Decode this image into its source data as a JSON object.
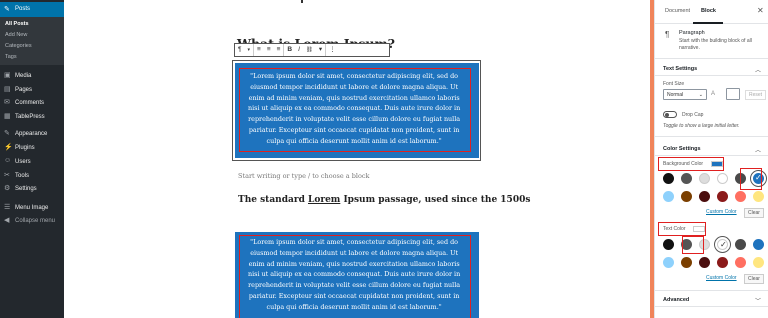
{
  "admin_menu": {
    "posts_label": "Posts",
    "sub_items": [
      "All Posts",
      "Add New",
      "Categories",
      "Tags"
    ],
    "items": [
      {
        "label": "Media",
        "icon": "media-icon",
        "glyph": "▣"
      },
      {
        "label": "Pages",
        "icon": "pages-icon",
        "glyph": "▤"
      },
      {
        "label": "Comments",
        "icon": "comments-icon",
        "glyph": "✉"
      },
      {
        "label": "TablePress",
        "icon": "tablepress-icon",
        "glyph": "▦"
      },
      {
        "label": "Appearance",
        "icon": "appearance-icon",
        "glyph": "✎"
      },
      {
        "label": "Plugins",
        "icon": "plugins-icon",
        "glyph": "⚡"
      },
      {
        "label": "Users",
        "icon": "users-icon",
        "glyph": "☺"
      },
      {
        "label": "Tools",
        "icon": "tools-icon",
        "glyph": "✂"
      },
      {
        "label": "Settings",
        "icon": "settings-icon",
        "glyph": "⚙"
      },
      {
        "label": "Menu Image",
        "icon": "menu-image-icon",
        "glyph": "☰"
      },
      {
        "label": "Collapse menu",
        "icon": "collapse-icon",
        "glyph": "◀"
      }
    ]
  },
  "editor": {
    "heading1": "What is Lorem Ipsum?",
    "toolbar": {
      "paragraph": "¶",
      "align_left": "≡",
      "align_center": "≡",
      "align_right": "≡",
      "bold": "B",
      "italic": "I",
      "link": "🔗",
      "more": "▾",
      "options": "⋮"
    },
    "paragraph_lines": [
      "\"Lorem  ipsum dolor sit amet, consectetur adipiscing elit, sed do",
      "eiusmod  tempor incididunt ut labore et dolore magna aliqua. Ut",
      "enim ad minim  veniam, quis nostrud exercitation ullamco laboris",
      "nisi ut aliquip ex ea  commodo consequat. Duis aute irure dolor in",
      "reprehenderit in voluptate  velit esse cillum dolore eu fugiat nulla",
      "pariatur. Excepteur sint  occaecat cupidatat non proident, sunt in",
      "culpa qui officia deserunt  mollit anim id est laborum.\""
    ],
    "placeholder": "Start writing or type / to choose a block",
    "heading2_prefix": "The standard ",
    "heading2_underlined": "Lorem",
    "heading2_suffix": " Ipsum passage, used since the 1500s",
    "block_color": "#1e73be"
  },
  "panel": {
    "tab_document": "Document",
    "tab_block": "Block",
    "close": "✕",
    "block_name": "Paragraph",
    "block_description": "Start with the building block of all narrative.",
    "text_settings": "Text Settings",
    "font_size_label": "Font Size",
    "font_size_value": "Normal",
    "reset_label": "Reset",
    "drop_cap_label": "Drop Cap",
    "drop_cap_hint": "Toggle to show a large initial letter.",
    "color_settings": "Color Settings",
    "background_color_label": "Background Color",
    "text_color_label": "Text Color",
    "custom_color": "Custom Color",
    "clear": "Clear",
    "advanced": "Advanced",
    "palette_row1": [
      "#111111",
      "#555555",
      "#dddddd",
      "#ffffff",
      "#4a4a4a",
      "#1e73be"
    ],
    "palette_row2": [
      "#8ed1fc",
      "#7b3f00",
      "#4a0e0e",
      "#8b1a1a",
      "#ff6f61",
      "#ffe680"
    ],
    "bg_selected": "#1e73be",
    "text_selected": "#ffffff"
  }
}
